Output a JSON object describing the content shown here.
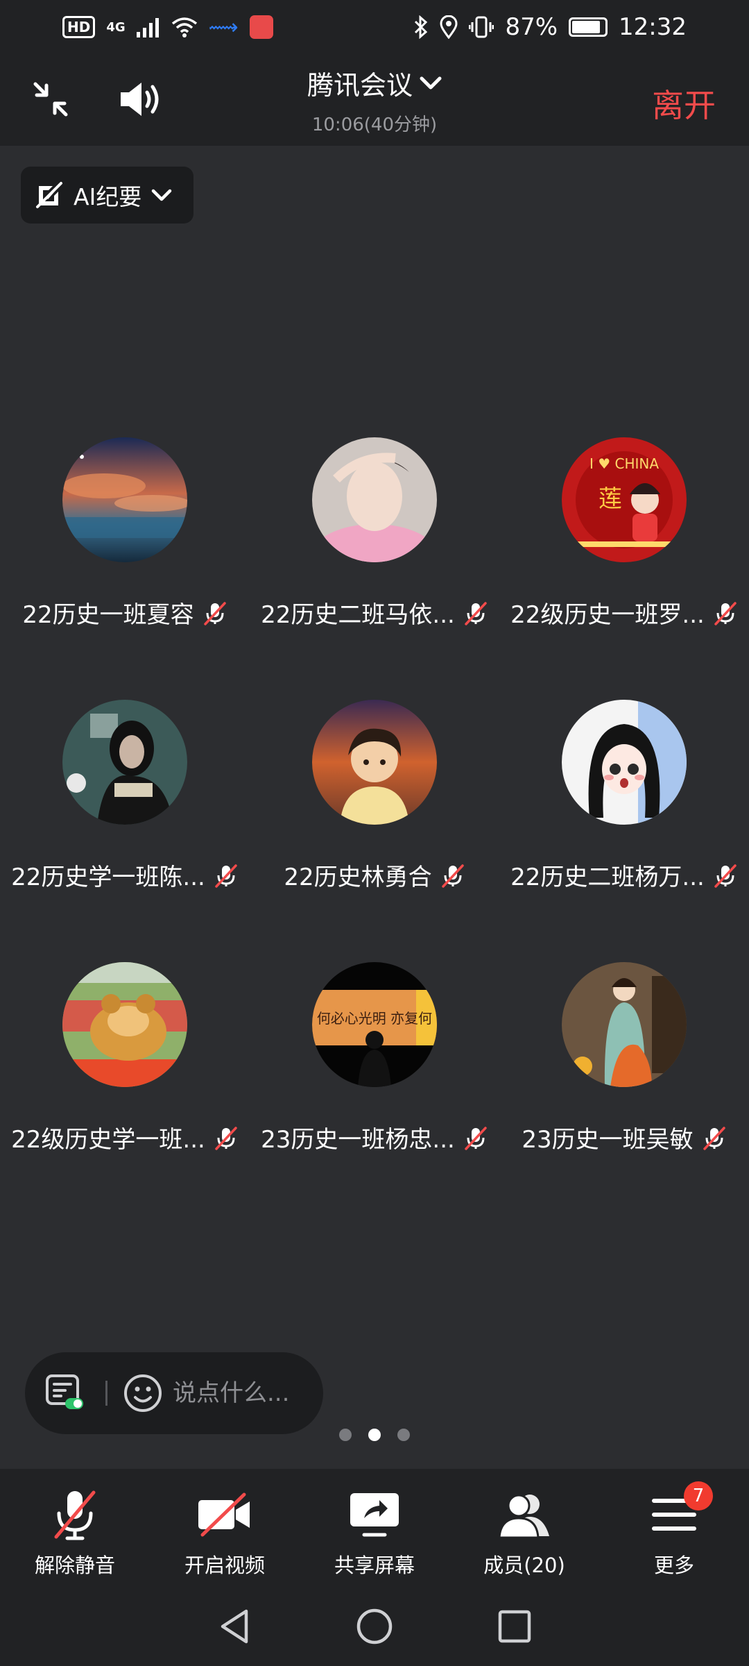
{
  "status_bar": {
    "hd": "HD",
    "network": "4G",
    "battery": "87%",
    "battery_level": 0.87,
    "time": "12:32"
  },
  "header": {
    "title": "腾讯会议",
    "subtitle": "10:06(40分钟)",
    "leave_label": "离开"
  },
  "ai_button": {
    "label": "AI纪要"
  },
  "participants": [
    {
      "name": "22历史一班夏容",
      "muted": true
    },
    {
      "name": "22历史二班马依...",
      "muted": true
    },
    {
      "name": "22级历史一班罗...",
      "muted": true
    },
    {
      "name": "22历史学一班陈...",
      "muted": true
    },
    {
      "name": "22历史林勇合",
      "muted": true
    },
    {
      "name": "22历史二班杨万...",
      "muted": true
    },
    {
      "name": "22级历史学一班...",
      "muted": true
    },
    {
      "name": "23历史一班杨忠...",
      "muted": true
    },
    {
      "name": "23历史一班吴敏",
      "muted": true
    }
  ],
  "avatar_texts": {
    "china_banner": "I ♥ CHINA",
    "china_char": "莲",
    "lake_text": "何必心光明 亦复何"
  },
  "chat": {
    "placeholder": "说点什么..."
  },
  "pager": {
    "count": 3,
    "active": 1
  },
  "toolbar": {
    "unmute": "解除静音",
    "video": "开启视频",
    "share": "共享屏幕",
    "members": "成员(20)",
    "more": "更多",
    "more_badge": "7"
  },
  "colors": {
    "background": "#2c2d30",
    "bar": "#212224",
    "leave": "#f24b4b",
    "badge": "#f13b2f",
    "mute_slash": "#f24b4b"
  }
}
